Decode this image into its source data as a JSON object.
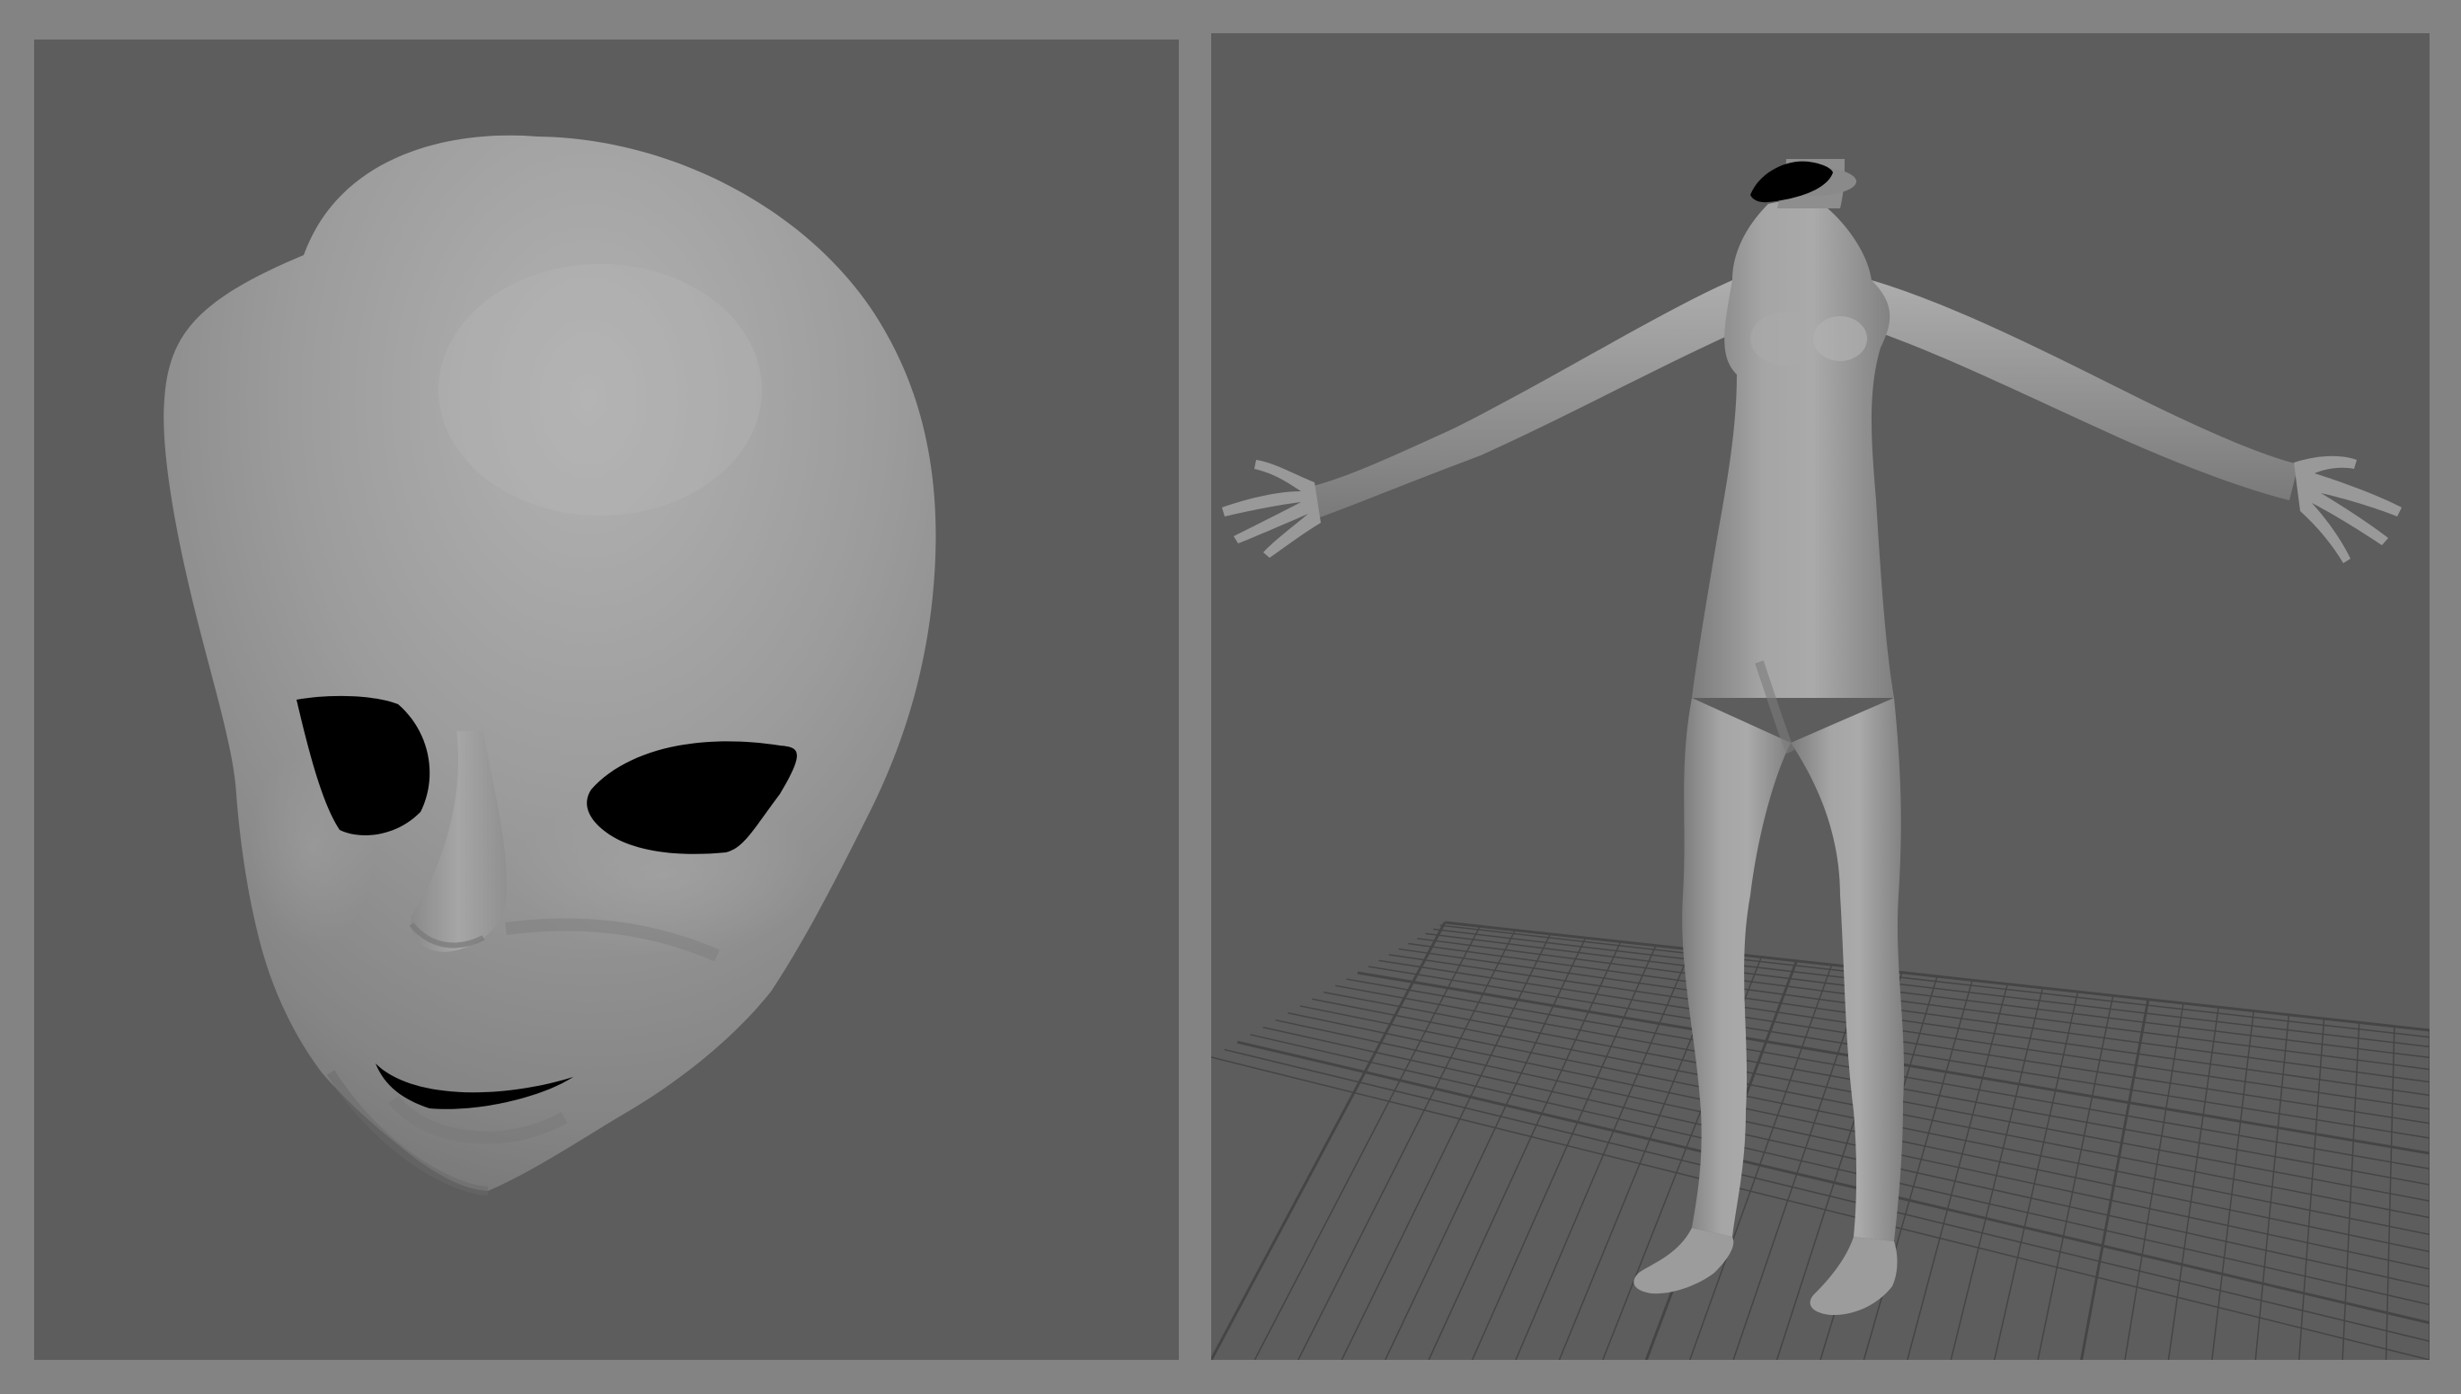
{
  "app": {
    "background_color": "#838383"
  },
  "viewports": {
    "left": {
      "subject": "head-sculpt",
      "background_color": "#5d5d5d",
      "mesh_color": "#9a9a9a",
      "eye_hole_color": "#000000"
    },
    "right": {
      "subject": "body-sculpt",
      "background_color": "#5d5d5d",
      "mesh_color": "#9c9c9c",
      "grid_color": "#454545",
      "neck_hole_color": "#000000"
    }
  }
}
